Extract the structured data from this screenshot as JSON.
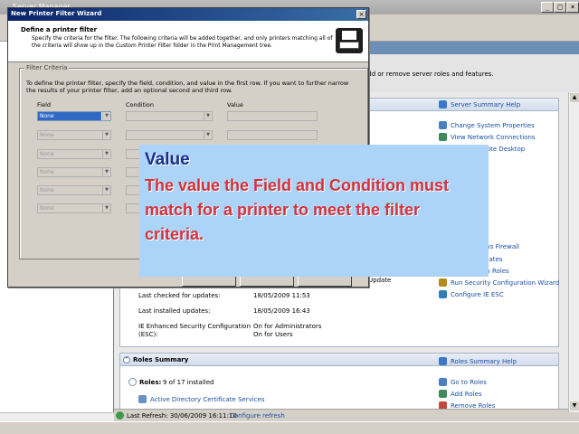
{
  "server_manager": {
    "title": "Server Manager",
    "header_desc": "add or remove server roles and features.",
    "summary_panel": {
      "help_link": "Server Summary Help",
      "links": [
        "Change System Properties",
        "View Network Connections",
        "mote Desktop",
        "ws Firewall",
        "dates",
        "w Roles",
        "Run Security Configuration Wizard",
        "Configure IE ESC"
      ]
    },
    "info": {
      "update_partial": "Update",
      "last_checked_label": "Last checked for updates:",
      "last_checked_value": "18/05/2009 11:53",
      "last_installed_label": "Last installed updates:",
      "last_installed_value": "18/05/2009 16:43",
      "ie_esc_label_1": "IE Enhanced Security Configuration",
      "ie_esc_label_2": "(ESC):",
      "ie_esc_value_1": "On for Administrators",
      "ie_esc_value_2": "On for Users"
    },
    "roles_panel": {
      "title": "Roles Summary",
      "help_link": "Roles Summary Help",
      "roles_label": "Roles:",
      "roles_count": "9 of 17 installed",
      "first_role": "Active Directory Certificate Services",
      "links": [
        "Go to Roles",
        "Add Roles",
        "Remove Roles"
      ]
    },
    "status": {
      "last_refresh": "Last Refresh: 30/06/2009 16:11:10",
      "configure_refresh": "Configure refresh"
    },
    "window_buttons": {
      "restore": "_",
      "maximize": " ",
      "close": "x"
    }
  },
  "wizard": {
    "title": "New Printer Filter Wizard",
    "step_title": "Define a printer filter",
    "step_desc": "Specify the criteria for the filter. The following criteria will be added together, and only printers matching all of the criteria will show up in the Custom Printer Filter folder in the Print Management tree.",
    "group_label": "Filter Criteria",
    "instructions": "To define the printer filter, specify the field, condition, and value in the first row. If you want to further narrow the results of your printer filter, add an optional second and third row.",
    "col_field": "Field",
    "col_condition": "Condition",
    "col_value": "Value",
    "rows": [
      {
        "field": "None"
      },
      {
        "field": "None"
      },
      {
        "field": "None"
      },
      {
        "field": "None"
      },
      {
        "field": "None"
      },
      {
        "field": "None"
      }
    ]
  },
  "callout": {
    "heading": "Value",
    "body": "The value the Field and Condition must match for a printer to meet the filter criteria."
  },
  "colors": {
    "callout_bg": "#acd4f8",
    "callout_heading": "#1a2d8a",
    "callout_body": "#d6313a",
    "titlebar": "#0a246a",
    "link": "#1b4fa3"
  }
}
